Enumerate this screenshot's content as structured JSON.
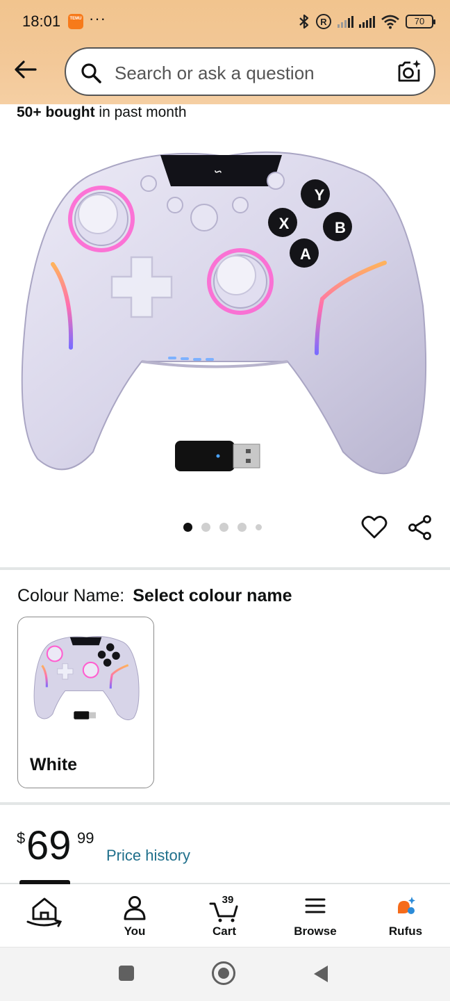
{
  "status": {
    "time": "18:01",
    "temu_icon_text": "TEMU",
    "overflow": "···",
    "battery": "70"
  },
  "header": {
    "search_placeholder": "Search or ask a question"
  },
  "product": {
    "bought_bold": "50+ bought",
    "bought_rest": " in past month",
    "gallery": {
      "pages": 5,
      "active_index": 0
    },
    "colour": {
      "label": "Colour Name:",
      "value": "Select colour name",
      "options": [
        {
          "name": "White"
        }
      ]
    },
    "price": {
      "currency": "$",
      "whole": "69",
      "fraction": "99",
      "history_link": "Price history"
    },
    "controller_buttons": {
      "y": "Y",
      "x": "X",
      "b": "B",
      "a": "A"
    }
  },
  "nav": {
    "items": [
      {
        "label": ""
      },
      {
        "label": "You"
      },
      {
        "label": "Cart",
        "count": "39"
      },
      {
        "label": "Browse"
      },
      {
        "label": "Rufus"
      }
    ]
  },
  "colors": {
    "header_bg": "#f3c898",
    "link": "#1f6f8b",
    "rufus_orange": "#f56b1a",
    "rufus_blue": "#2b8bd8"
  }
}
